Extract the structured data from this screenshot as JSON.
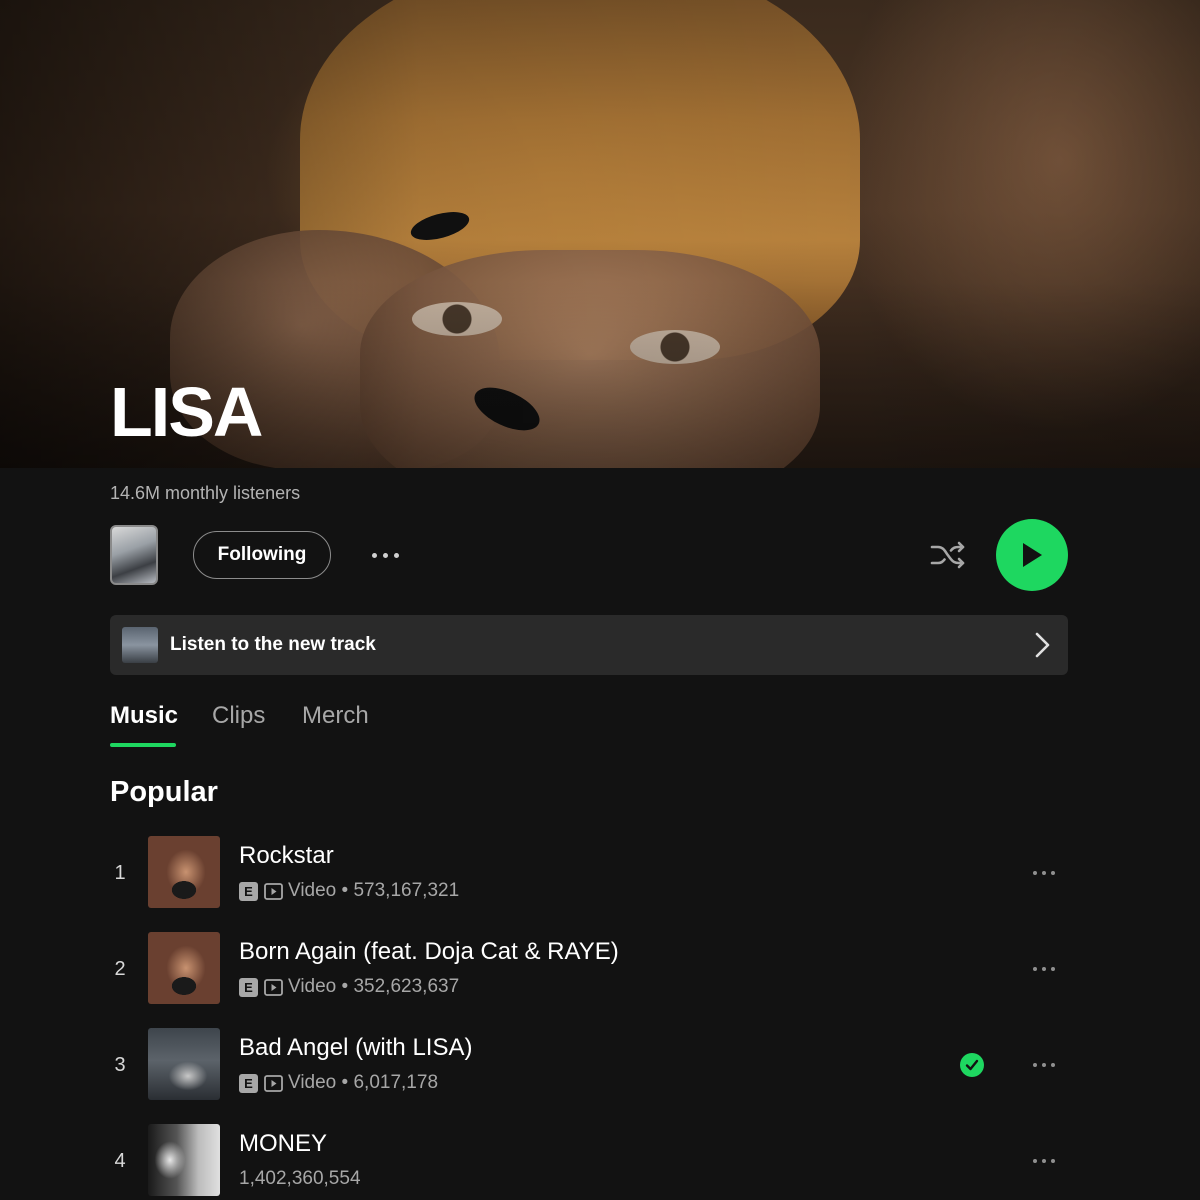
{
  "artist": {
    "name": "LISA",
    "monthly_listeners": "14.6M monthly listeners"
  },
  "actions": {
    "follow_label": "Following",
    "more_icon": "more-horizontal-icon",
    "shuffle_icon": "shuffle-icon",
    "play_icon": "play-icon",
    "accent_color": "#1ed760"
  },
  "banner": {
    "label": "Listen to the new track",
    "chevron_icon": "chevron-right-icon"
  },
  "tabs": [
    {
      "label": "Music",
      "active": true
    },
    {
      "label": "Clips",
      "active": false
    },
    {
      "label": "Merch",
      "active": false
    }
  ],
  "popular": {
    "heading": "Popular",
    "tracks": [
      {
        "rank": "1",
        "title": "Rockstar",
        "explicit": "E",
        "video_label": "Video",
        "plays": "573,167,321",
        "saved": false
      },
      {
        "rank": "2",
        "title": "Born Again (feat. Doja Cat & RAYE)",
        "explicit": "E",
        "video_label": "Video",
        "plays": "352,623,637",
        "saved": false
      },
      {
        "rank": "3",
        "title": "Bad Angel (with LISA)",
        "explicit": "E",
        "video_label": "Video",
        "plays": "6,017,178",
        "saved": true
      },
      {
        "rank": "4",
        "title": "MONEY",
        "explicit": "",
        "video_label": "",
        "plays": "1,402,360,554",
        "saved": false
      }
    ]
  }
}
